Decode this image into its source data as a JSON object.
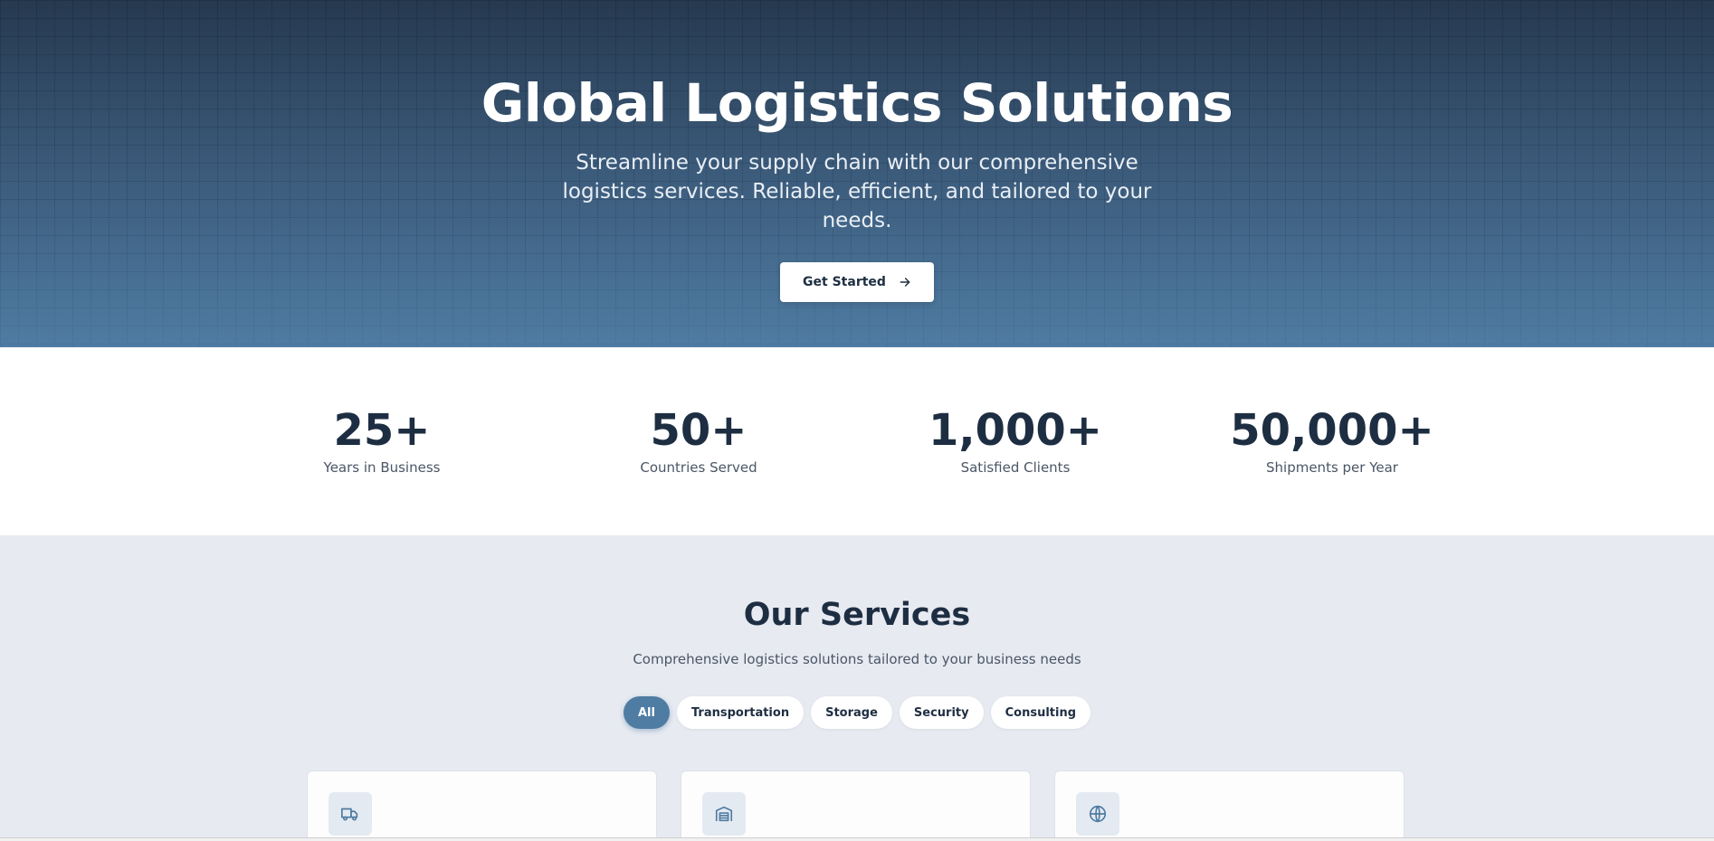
{
  "hero": {
    "title": "Global Logistics Solutions",
    "subtitle": "Streamline your supply chain with our comprehensive logistics services. Reliable, efficient, and tailored to your needs.",
    "cta_label": "Get Started",
    "cta_icon": "arrow-right-icon"
  },
  "stats": [
    {
      "value": "25+",
      "label": "Years in Business"
    },
    {
      "value": "50+",
      "label": "Countries Served"
    },
    {
      "value": "1,000+",
      "label": "Satisfied Clients"
    },
    {
      "value": "50,000+",
      "label": "Shipments per Year"
    }
  ],
  "services": {
    "title": "Our Services",
    "subtitle": "Comprehensive logistics solutions tailored to your business needs",
    "filters": [
      {
        "label": "All",
        "active": true
      },
      {
        "label": "Transportation",
        "active": false
      },
      {
        "label": "Storage",
        "active": false
      },
      {
        "label": "Security",
        "active": false
      },
      {
        "label": "Consulting",
        "active": false
      }
    ],
    "cards": [
      {
        "icon": "truck-icon"
      },
      {
        "icon": "warehouse-icon"
      },
      {
        "icon": "globe-icon"
      }
    ]
  },
  "colors": {
    "accent": "#4f7ca3",
    "hero_top": "#26394f",
    "hero_bottom": "#4f7ca3",
    "text_dark": "#1e2e42",
    "section_bg": "#e7eaf1"
  }
}
